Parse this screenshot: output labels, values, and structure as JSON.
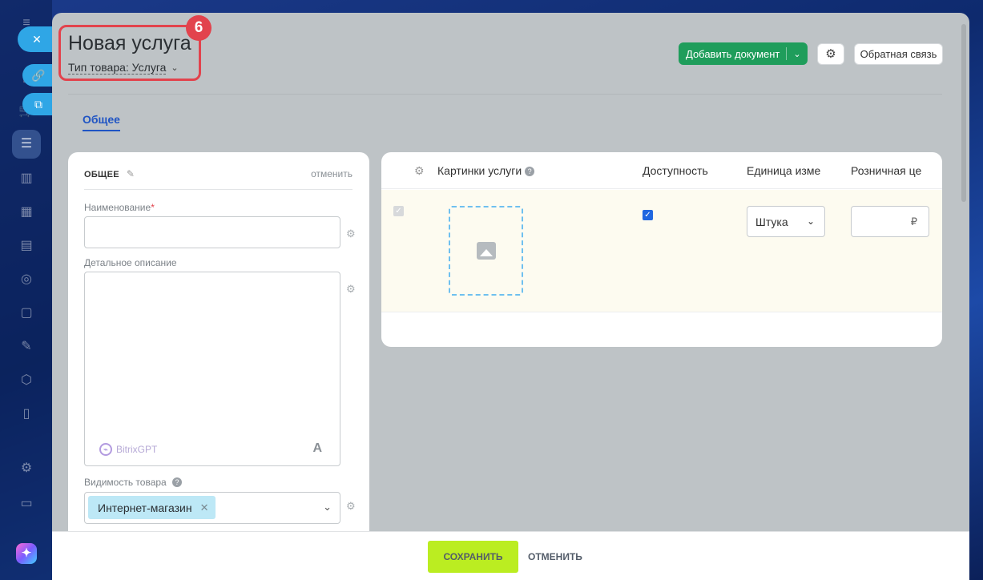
{
  "header": {
    "title": "Новая услуга",
    "product_type_label": "Тип товара: Услуга",
    "step_badge": "6",
    "add_document_label": "Добавить документ",
    "feedback_label": "Обратная связь"
  },
  "tabs": [
    {
      "label": "Общее",
      "active": true
    }
  ],
  "general_section": {
    "title": "ОБЩЕЕ",
    "cancel_label": "отменить",
    "name_label": "Наименование",
    "required_mark": "*",
    "description_label": "Детальное описание",
    "bitrixgpt_label": "BitrixGPT",
    "format_icon_label": "A",
    "visibility_label": "Видимость товара",
    "visibility_tag": "Интернет-магазин"
  },
  "grid": {
    "columns": {
      "images": "Картинки услуги",
      "availability": "Доступность",
      "unit": "Единица изме",
      "price": "Розничная це"
    },
    "row": {
      "availability_checked": true,
      "unit_value": "Штука",
      "currency_symbol": "₽"
    }
  },
  "footer": {
    "save_label": "СОХРАНИТЬ",
    "cancel_label": "ОТМЕНИТЬ"
  },
  "colors": {
    "accent_green": "#1f9d5b",
    "save_green": "#bbed21",
    "highlight_red": "#e2434d",
    "tab_blue": "#1f54c4"
  },
  "icons": {
    "close": "close-icon",
    "link": "link-icon",
    "open": "open-window-icon",
    "settings": "gear-icon",
    "image": "image-placeholder-icon",
    "help": "help-icon"
  }
}
